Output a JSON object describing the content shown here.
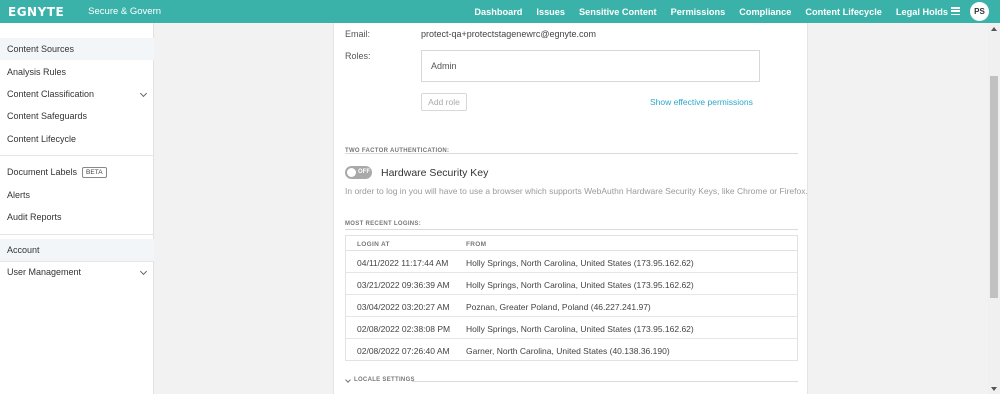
{
  "header": {
    "logo": "EGNYTE",
    "app_name": "Secure & Govern",
    "nav": [
      "Dashboard",
      "Issues",
      "Sensitive Content",
      "Permissions",
      "Compliance",
      "Content Lifecycle",
      "Legal Holds"
    ],
    "avatar_initials": "PS",
    "menu_icon": "hamburger-icon",
    "bar_color": "#3ab2a9"
  },
  "sidebar": {
    "items": [
      {
        "label": "Content Sources",
        "active": true
      },
      {
        "label": "Analysis Rules"
      },
      {
        "label": "Content Classification",
        "has_chevron": true
      },
      {
        "label": "Content Safeguards"
      },
      {
        "label": "Content Lifecycle"
      },
      {
        "label": "Document Labels",
        "badge": "BETA"
      },
      {
        "label": "Alerts"
      },
      {
        "label": "Audit Reports"
      },
      {
        "label": "Account",
        "active": true
      },
      {
        "label": "User Management",
        "has_chevron": true
      }
    ]
  },
  "user": {
    "email_label": "Email:",
    "email": "protect-qa+protectstagenewrc@egnyte.com",
    "roles_label": "Roles:",
    "role": "Admin",
    "add_role_label": "Add role",
    "effective_permissions_link": "Show effective permissions"
  },
  "two_factor": {
    "section_title": "TWO FACTOR AUTHENTICATION:",
    "toggle_label": "OFF",
    "toggle_on": false,
    "title": "Hardware Security Key",
    "hint": "In order to log in you will have to use a browser which supports WebAuthn Hardware Security Keys, like Chrome or Firefox."
  },
  "logins": {
    "section_title": "MOST RECENT LOGINS:",
    "columns": [
      "LOGIN AT",
      "FROM"
    ],
    "rows": [
      [
        "04/11/2022 11:17:44 AM",
        "Holly Springs, North Carolina, United States (173.95.162.62)"
      ],
      [
        "03/21/2022 09:36:39 AM",
        "Holly Springs, North Carolina, United States (173.95.162.62)"
      ],
      [
        "03/04/2022 03:20:27 AM",
        "Poznan, Greater Poland, Poland (46.227.241.97)"
      ],
      [
        "02/08/2022 02:38:08 PM",
        "Holly Springs, North Carolina, United States (173.95.162.62)"
      ],
      [
        "02/08/2022 07:26:40 AM",
        "Garner, North Carolina, United States (40.138.36.190)"
      ]
    ]
  },
  "locale": {
    "section_title": "LOCALE SETTINGS"
  }
}
